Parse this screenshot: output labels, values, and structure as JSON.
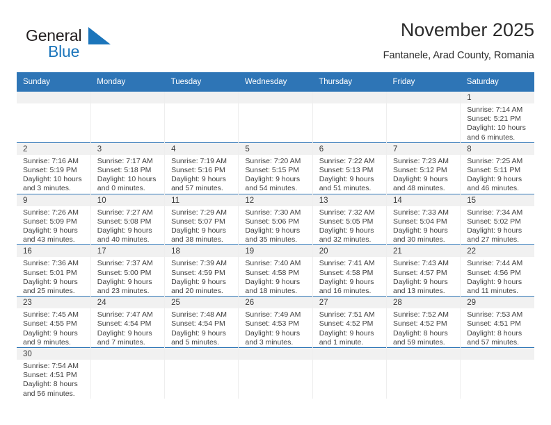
{
  "brand": {
    "name_top": "General",
    "name_bottom": "Blue",
    "sail_icon": "sail-triangle-icon",
    "color_dark": "#231f20",
    "color_blue": "#1b75bb"
  },
  "header": {
    "title": "November 2025",
    "subtitle": "Fantanele, Arad County, Romania",
    "accent_color": "#2e75b6"
  },
  "calendar": {
    "weekday_headers": [
      "Sunday",
      "Monday",
      "Tuesday",
      "Wednesday",
      "Thursday",
      "Friday",
      "Saturday"
    ],
    "labels": {
      "sunrise_prefix": "Sunrise:",
      "sunset_prefix": "Sunset:",
      "daylight_prefix": "Daylight:"
    },
    "weeks": [
      [
        {
          "day": "",
          "empty": true
        },
        {
          "day": "",
          "empty": true
        },
        {
          "day": "",
          "empty": true
        },
        {
          "day": "",
          "empty": true
        },
        {
          "day": "",
          "empty": true
        },
        {
          "day": "",
          "empty": true
        },
        {
          "day": "1",
          "sunrise": "Sunrise: 7:14 AM",
          "sunset": "Sunset: 5:21 PM",
          "daylight_1": "Daylight: 10 hours",
          "daylight_2": "and 6 minutes."
        }
      ],
      [
        {
          "day": "2",
          "sunrise": "Sunrise: 7:16 AM",
          "sunset": "Sunset: 5:19 PM",
          "daylight_1": "Daylight: 10 hours",
          "daylight_2": "and 3 minutes."
        },
        {
          "day": "3",
          "sunrise": "Sunrise: 7:17 AM",
          "sunset": "Sunset: 5:18 PM",
          "daylight_1": "Daylight: 10 hours",
          "daylight_2": "and 0 minutes."
        },
        {
          "day": "4",
          "sunrise": "Sunrise: 7:19 AM",
          "sunset": "Sunset: 5:16 PM",
          "daylight_1": "Daylight: 9 hours",
          "daylight_2": "and 57 minutes."
        },
        {
          "day": "5",
          "sunrise": "Sunrise: 7:20 AM",
          "sunset": "Sunset: 5:15 PM",
          "daylight_1": "Daylight: 9 hours",
          "daylight_2": "and 54 minutes."
        },
        {
          "day": "6",
          "sunrise": "Sunrise: 7:22 AM",
          "sunset": "Sunset: 5:13 PM",
          "daylight_1": "Daylight: 9 hours",
          "daylight_2": "and 51 minutes."
        },
        {
          "day": "7",
          "sunrise": "Sunrise: 7:23 AM",
          "sunset": "Sunset: 5:12 PM",
          "daylight_1": "Daylight: 9 hours",
          "daylight_2": "and 48 minutes."
        },
        {
          "day": "8",
          "sunrise": "Sunrise: 7:25 AM",
          "sunset": "Sunset: 5:11 PM",
          "daylight_1": "Daylight: 9 hours",
          "daylight_2": "and 46 minutes."
        }
      ],
      [
        {
          "day": "9",
          "sunrise": "Sunrise: 7:26 AM",
          "sunset": "Sunset: 5:09 PM",
          "daylight_1": "Daylight: 9 hours",
          "daylight_2": "and 43 minutes."
        },
        {
          "day": "10",
          "sunrise": "Sunrise: 7:27 AM",
          "sunset": "Sunset: 5:08 PM",
          "daylight_1": "Daylight: 9 hours",
          "daylight_2": "and 40 minutes."
        },
        {
          "day": "11",
          "sunrise": "Sunrise: 7:29 AM",
          "sunset": "Sunset: 5:07 PM",
          "daylight_1": "Daylight: 9 hours",
          "daylight_2": "and 38 minutes."
        },
        {
          "day": "12",
          "sunrise": "Sunrise: 7:30 AM",
          "sunset": "Sunset: 5:06 PM",
          "daylight_1": "Daylight: 9 hours",
          "daylight_2": "and 35 minutes."
        },
        {
          "day": "13",
          "sunrise": "Sunrise: 7:32 AM",
          "sunset": "Sunset: 5:05 PM",
          "daylight_1": "Daylight: 9 hours",
          "daylight_2": "and 32 minutes."
        },
        {
          "day": "14",
          "sunrise": "Sunrise: 7:33 AM",
          "sunset": "Sunset: 5:04 PM",
          "daylight_1": "Daylight: 9 hours",
          "daylight_2": "and 30 minutes."
        },
        {
          "day": "15",
          "sunrise": "Sunrise: 7:34 AM",
          "sunset": "Sunset: 5:02 PM",
          "daylight_1": "Daylight: 9 hours",
          "daylight_2": "and 27 minutes."
        }
      ],
      [
        {
          "day": "16",
          "sunrise": "Sunrise: 7:36 AM",
          "sunset": "Sunset: 5:01 PM",
          "daylight_1": "Daylight: 9 hours",
          "daylight_2": "and 25 minutes."
        },
        {
          "day": "17",
          "sunrise": "Sunrise: 7:37 AM",
          "sunset": "Sunset: 5:00 PM",
          "daylight_1": "Daylight: 9 hours",
          "daylight_2": "and 23 minutes."
        },
        {
          "day": "18",
          "sunrise": "Sunrise: 7:39 AM",
          "sunset": "Sunset: 4:59 PM",
          "daylight_1": "Daylight: 9 hours",
          "daylight_2": "and 20 minutes."
        },
        {
          "day": "19",
          "sunrise": "Sunrise: 7:40 AM",
          "sunset": "Sunset: 4:58 PM",
          "daylight_1": "Daylight: 9 hours",
          "daylight_2": "and 18 minutes."
        },
        {
          "day": "20",
          "sunrise": "Sunrise: 7:41 AM",
          "sunset": "Sunset: 4:58 PM",
          "daylight_1": "Daylight: 9 hours",
          "daylight_2": "and 16 minutes."
        },
        {
          "day": "21",
          "sunrise": "Sunrise: 7:43 AM",
          "sunset": "Sunset: 4:57 PM",
          "daylight_1": "Daylight: 9 hours",
          "daylight_2": "and 13 minutes."
        },
        {
          "day": "22",
          "sunrise": "Sunrise: 7:44 AM",
          "sunset": "Sunset: 4:56 PM",
          "daylight_1": "Daylight: 9 hours",
          "daylight_2": "and 11 minutes."
        }
      ],
      [
        {
          "day": "23",
          "sunrise": "Sunrise: 7:45 AM",
          "sunset": "Sunset: 4:55 PM",
          "daylight_1": "Daylight: 9 hours",
          "daylight_2": "and 9 minutes."
        },
        {
          "day": "24",
          "sunrise": "Sunrise: 7:47 AM",
          "sunset": "Sunset: 4:54 PM",
          "daylight_1": "Daylight: 9 hours",
          "daylight_2": "and 7 minutes."
        },
        {
          "day": "25",
          "sunrise": "Sunrise: 7:48 AM",
          "sunset": "Sunset: 4:54 PM",
          "daylight_1": "Daylight: 9 hours",
          "daylight_2": "and 5 minutes."
        },
        {
          "day": "26",
          "sunrise": "Sunrise: 7:49 AM",
          "sunset": "Sunset: 4:53 PM",
          "daylight_1": "Daylight: 9 hours",
          "daylight_2": "and 3 minutes."
        },
        {
          "day": "27",
          "sunrise": "Sunrise: 7:51 AM",
          "sunset": "Sunset: 4:52 PM",
          "daylight_1": "Daylight: 9 hours",
          "daylight_2": "and 1 minute."
        },
        {
          "day": "28",
          "sunrise": "Sunrise: 7:52 AM",
          "sunset": "Sunset: 4:52 PM",
          "daylight_1": "Daylight: 8 hours",
          "daylight_2": "and 59 minutes."
        },
        {
          "day": "29",
          "sunrise": "Sunrise: 7:53 AM",
          "sunset": "Sunset: 4:51 PM",
          "daylight_1": "Daylight: 8 hours",
          "daylight_2": "and 57 minutes."
        }
      ],
      [
        {
          "day": "30",
          "sunrise": "Sunrise: 7:54 AM",
          "sunset": "Sunset: 4:51 PM",
          "daylight_1": "Daylight: 8 hours",
          "daylight_2": "and 56 minutes."
        },
        {
          "day": "",
          "empty": true
        },
        {
          "day": "",
          "empty": true
        },
        {
          "day": "",
          "empty": true
        },
        {
          "day": "",
          "empty": true
        },
        {
          "day": "",
          "empty": true
        },
        {
          "day": "",
          "empty": true
        }
      ]
    ]
  }
}
